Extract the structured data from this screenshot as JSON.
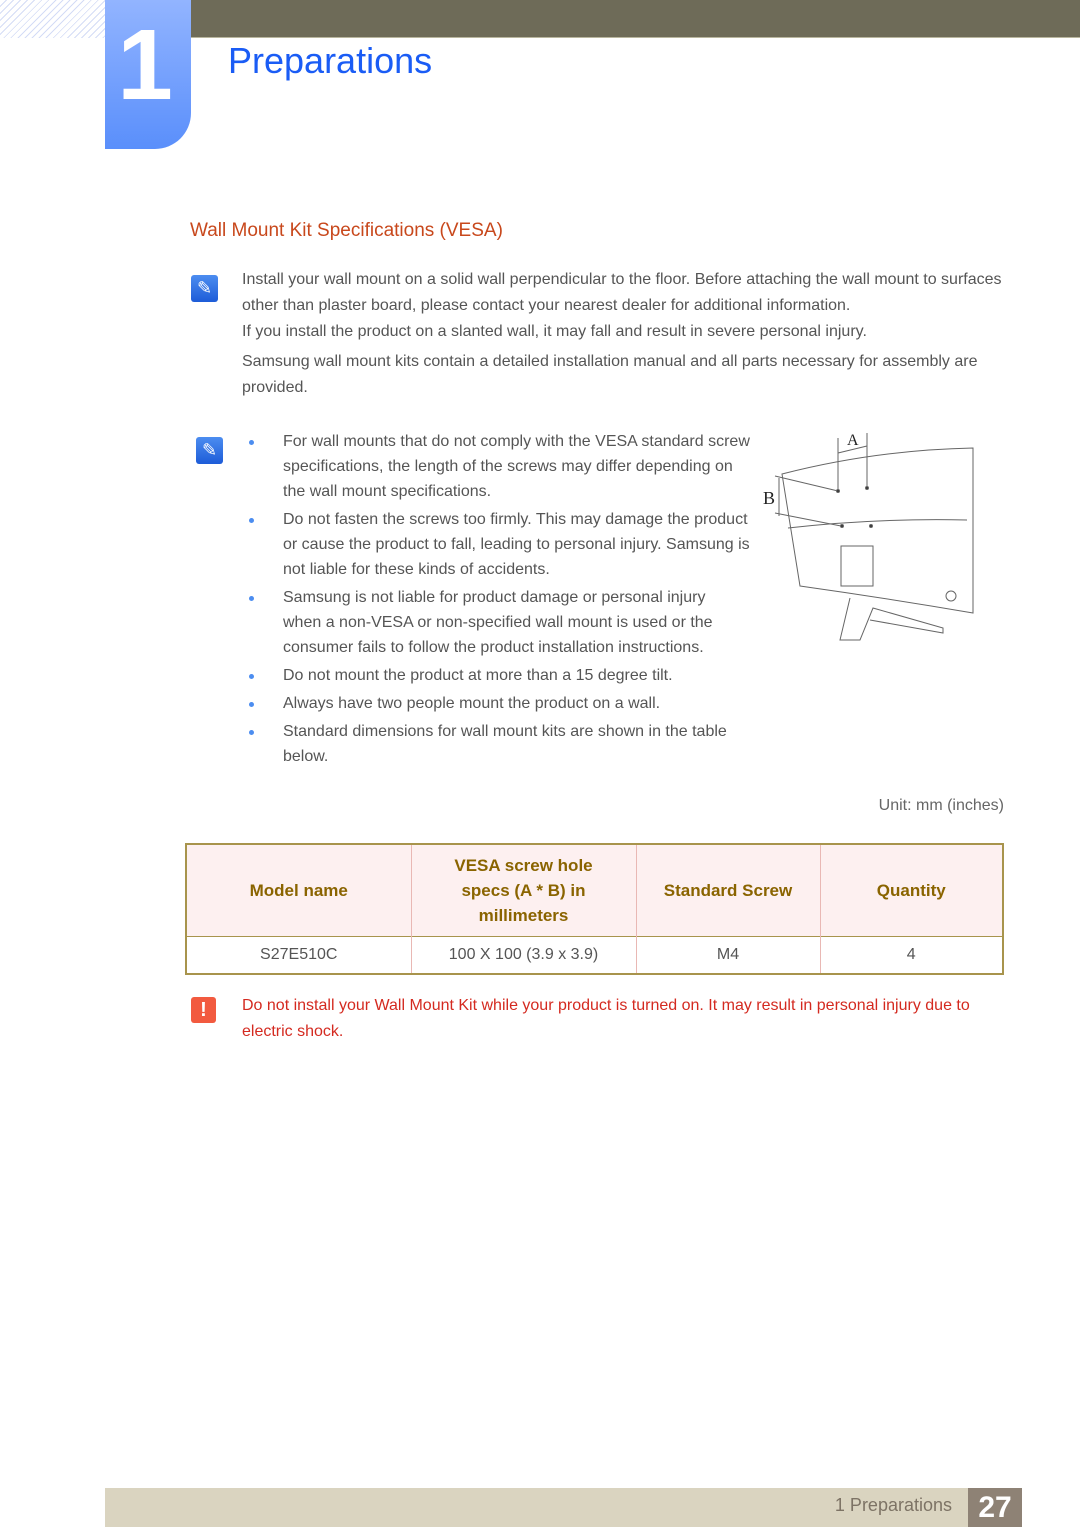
{
  "chapter": {
    "number": "1",
    "title": "Preparations"
  },
  "section_title": "Wall Mount Kit Specifications (VESA)",
  "note1": {
    "icon": "note-pencil-icon",
    "lines": [
      "Install your wall mount on a solid wall perpendicular to the floor. Before attaching the wall mount to surfaces other than plaster board, please contact your nearest dealer for additional information.",
      "If you install the product on a slanted wall, it may fall and result in severe personal injury.",
      "Samsung wall mount kits contain a detailed installation manual and all parts necessary for assembly are provided."
    ]
  },
  "note2": {
    "icon": "note-pencil-icon",
    "bullets": [
      "For wall mounts that do not comply with the VESA standard screw specifications, the length of the screws may differ depending on the wall mount specifications.",
      "Do not fasten the screws too firmly. This may damage the product or cause the product to fall, leading to personal injury. Samsung is not liable for these kinds of accidents.",
      "Samsung is not liable for product damage or personal injury when a non-VESA or non-specified wall mount is used or the consumer fails to follow the product installation instructions.",
      "Do not mount the product at more than a 15 degree tilt.",
      "Always have two people mount the product on a wall.",
      "Standard dimensions for wall mount kits are shown in the table below."
    ]
  },
  "figure": {
    "label_a": "A",
    "label_b": "B"
  },
  "unit": "Unit:  mm  (inches)",
  "table": {
    "headers": [
      "Model name",
      "VESA screw hole specs (A * B) in millimeters",
      "Standard Screw",
      "Quantity"
    ],
    "rows": [
      [
        "S27E510C",
        "100  X  100  (3.9 x 3.9)",
        "M4",
        "4"
      ]
    ]
  },
  "warning": {
    "icon": "warning-icon",
    "text": "Do not install your Wall Mount Kit while your product is turned on. It may result in personal injury due to electric shock."
  },
  "footer": {
    "label": "1 Preparations",
    "page": "27"
  }
}
